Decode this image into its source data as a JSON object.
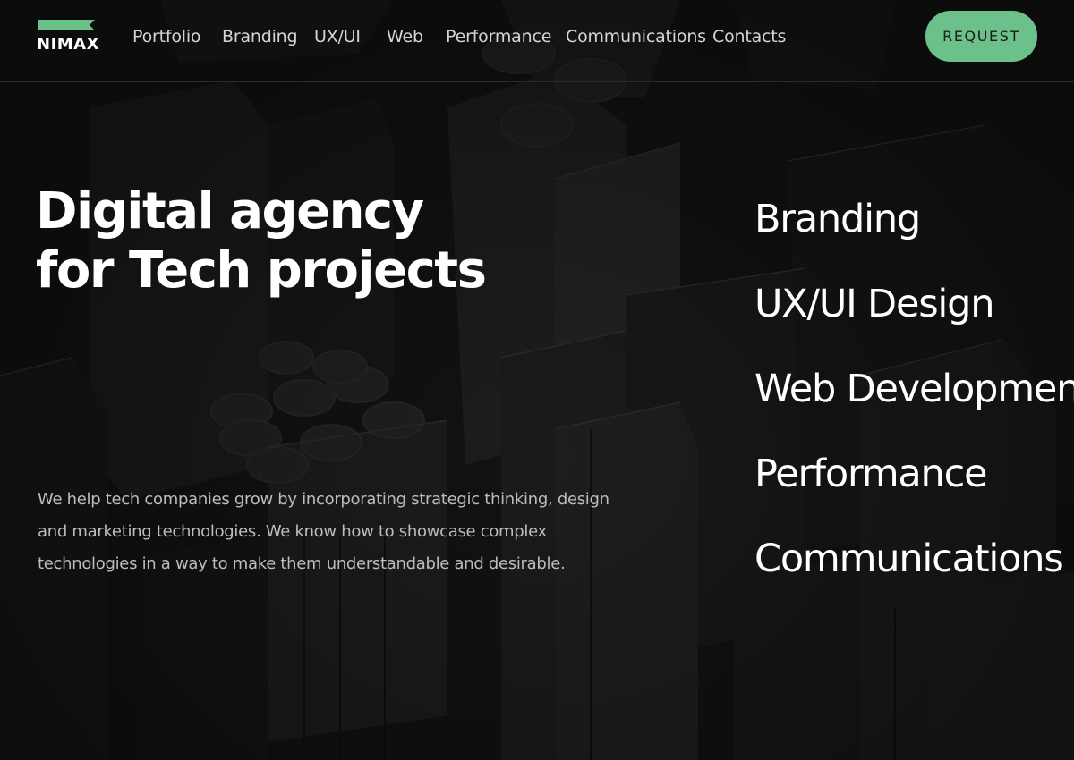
{
  "brand": {
    "logo_text": "NIMAX",
    "accent_color": "#6cc08a",
    "background_color": "#111111"
  },
  "nav": {
    "items": [
      {
        "label": "Portfolio"
      },
      {
        "label": "Branding"
      },
      {
        "label": "UX/UI"
      },
      {
        "label": "Web"
      },
      {
        "label": "Performance"
      },
      {
        "label": "Communications"
      },
      {
        "label": "Contacts"
      }
    ],
    "request_label": "REQUEST"
  },
  "hero": {
    "title_line1": "Digital agency",
    "title_line2": "for Tech projects",
    "description": "We help tech companies grow by incorporating strategic thinking, design and marketing technologies. We know how to showcase complex technologies in a way to make them understandable and desirable."
  },
  "services": [
    {
      "label": "Branding"
    },
    {
      "label": "UX/UI Design"
    },
    {
      "label": "Web Development"
    },
    {
      "label": "Performance"
    },
    {
      "label": "Communications"
    }
  ]
}
